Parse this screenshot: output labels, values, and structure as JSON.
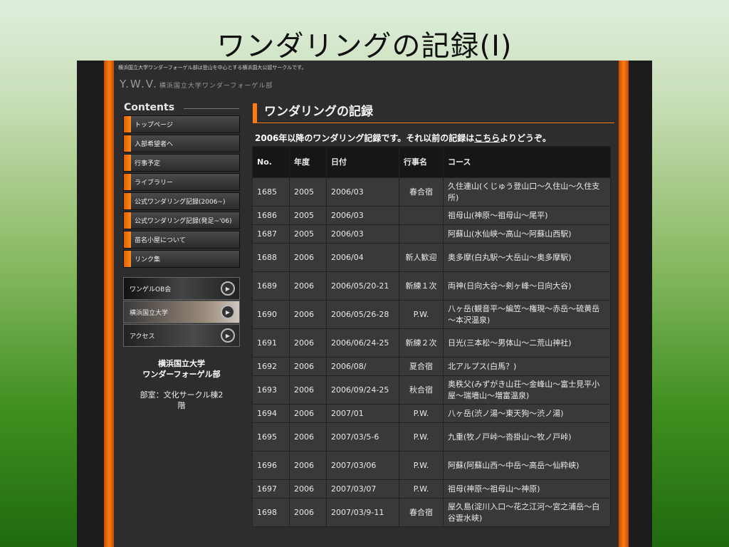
{
  "slide": {
    "title": "ワンダリングの記録(Ⅰ)"
  },
  "site": {
    "tagline": "横浜国立大学ワンダーフォーゲル部は登山を中心とする横浜国大公認サークルです。",
    "logo": {
      "text": "Y.W.V.",
      "subtitle": "横浜国立大学ワンダーフォーゲル部"
    },
    "accent_color": "#ff7a10"
  },
  "sidebar": {
    "heading": "Contents",
    "menu": [
      {
        "label": "トップページ"
      },
      {
        "label": "入部希望者へ"
      },
      {
        "label": "行事予定"
      },
      {
        "label": "ライブラリー"
      },
      {
        "label": "公式ワンダリング記録(2006~)"
      },
      {
        "label": "公式ワンダリング記録(発足~'06)"
      },
      {
        "label": "苗名小屋について"
      },
      {
        "label": "リンク集"
      }
    ],
    "banners": [
      {
        "label": "ワンゲルOB会",
        "icon": "play-icon"
      },
      {
        "label": "横浜国立大学",
        "icon": "play-icon"
      },
      {
        "label": "アクセス",
        "icon": "play-icon"
      }
    ],
    "club_name": [
      "横浜国立大学",
      "ワンダーフォーゲル部"
    ],
    "room": [
      "部室：文化サークル棟2",
      "階"
    ]
  },
  "main": {
    "title": "ワンダリングの記録",
    "intro_prefix": "2006年以降のワンダリング記録です。それ以前の記録は",
    "intro_link": "こちら",
    "intro_suffix": "よりどうぞ。",
    "table": {
      "headers": [
        "No.",
        "年度",
        "日付",
        "行事名",
        "コース"
      ],
      "rows": [
        [
          "1685",
          "2005",
          "2006/03",
          "春合宿",
          "久住連山(くじゅう登山口～久住山～久住支所)"
        ],
        [
          "1686",
          "2005",
          "2006/03",
          "",
          "祖母山(神原～祖母山～尾平)"
        ],
        [
          "1687",
          "2005",
          "2006/03",
          "",
          "阿蘇山(水仙峡～高山～阿蘇山西駅)"
        ],
        [
          "1688",
          "2006",
          "2006/04",
          "新人歓迎",
          "奥多摩(白丸駅～大岳山～奥多摩駅)"
        ],
        [
          "1689",
          "2006",
          "2006/05/20-21",
          "新練１次",
          "両神(日向大谷～剣ヶ峰～日向大谷)"
        ],
        [
          "1690",
          "2006",
          "2006/05/26-28",
          "P.W.",
          "八ヶ岳(観音平～編笠～権現～赤岳～硫黄岳～本沢温泉)"
        ],
        [
          "1691",
          "2006",
          "2006/06/24-25",
          "新練２次",
          "日光(三本松～男体山～二荒山神社)"
        ],
        [
          "1692",
          "2006",
          "2006/08/",
          "夏合宿",
          "北アルプス(白馬？)"
        ],
        [
          "1693",
          "2006",
          "2006/09/24-25",
          "秋合宿",
          "奥秩父(みずがき山荘～金峰山～富士見平小屋～瑞墻山～増富温泉)"
        ],
        [
          "1694",
          "2006",
          "2007/01",
          "P.W.",
          "八ヶ岳(渋ノ湯～東天狗～渋ノ湯)"
        ],
        [
          "1695",
          "2006",
          "2007/03/5-6",
          "P.W.",
          "九重(牧ノ戸峠～沓掛山～牧ノ戸峠)"
        ],
        [
          "1696",
          "2006",
          "2007/03/06",
          "P.W.",
          "阿蘇(阿蘇山西～中岳～高岳～仙粋峡)"
        ],
        [
          "1697",
          "2006",
          "2007/03/07",
          "P.W.",
          "祖母(神原～祖母山～神原)"
        ],
        [
          "1698",
          "2006",
          "2007/03/9-11",
          "春合宿",
          "屋久島(淀川入口～花之江河～宮之浦岳～白谷雲水峡)"
        ]
      ]
    }
  }
}
